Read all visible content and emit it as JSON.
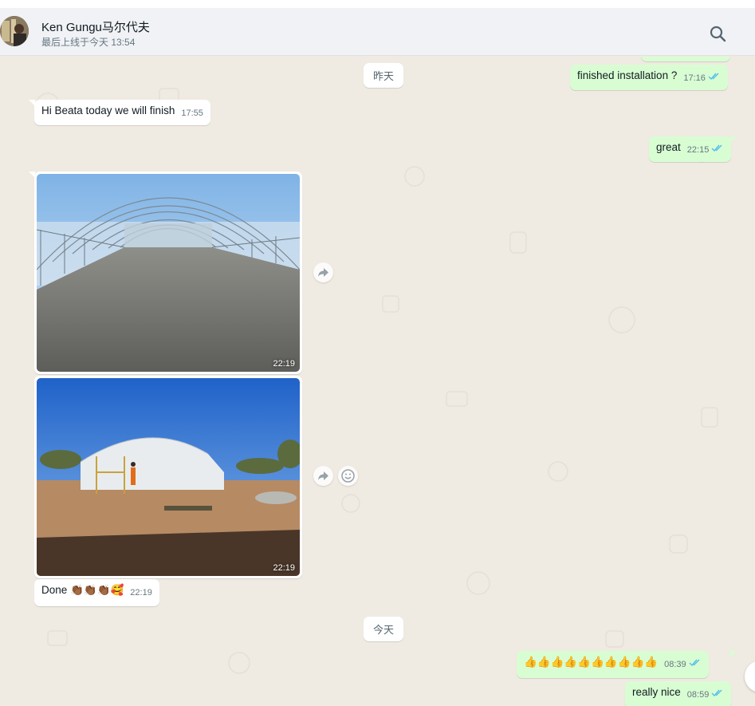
{
  "window": {
    "top_strip": ""
  },
  "header": {
    "contact_name": "Ken Gungu马尔代夫",
    "last_seen": "最后上线于今天 13:54",
    "search_icon": "search-icon"
  },
  "chat": {
    "date_yesterday": "昨天",
    "date_today": "今天",
    "msg_top_partial_time": "17:16",
    "msg_finished_text": "finished installation ?",
    "msg_finished_time": "17:16",
    "msg_hi_text": "Hi Beata today we will finish",
    "msg_hi_time": "17:55",
    "msg_great_text": "great",
    "msg_great_time": "22:15",
    "image1_time": "22:19",
    "image2_time": "22:19",
    "msg_done_text": "Done",
    "msg_done_emoji": "👏🏾👏🏾👏🏾🥰",
    "msg_done_time": "22:19",
    "msg_thumbs_emoji": "👍👍👍👍👍👍👍👍👍👍",
    "msg_thumbs_time": "08:39",
    "msg_nice_text": "really nice",
    "msg_nice_time": "08:59"
  },
  "colors": {
    "bg": "#efeae2",
    "outgoing": "#d9fdd3",
    "incoming": "#ffffff",
    "read_tick": "#53bdeb"
  }
}
